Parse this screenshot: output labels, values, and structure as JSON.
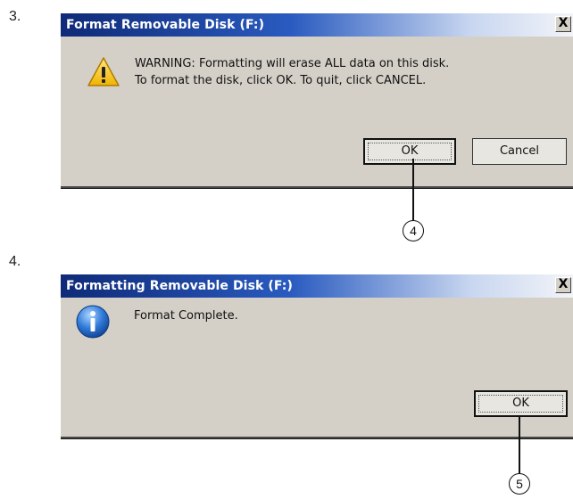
{
  "steps": {
    "step3": "3.",
    "step4": "4."
  },
  "dialog1": {
    "title": "Format Removable Disk (F:)",
    "close_label": "X",
    "icon": "warning-icon",
    "message_line1": "WARNING: Formatting will erase ALL data on this disk.",
    "message_line2": "To format the disk, click OK. To quit, click CANCEL.",
    "ok_label": "OK",
    "cancel_label": "Cancel",
    "callout": "4"
  },
  "dialog2": {
    "title": "Formatting Removable Disk (F:)",
    "close_label": "X",
    "icon": "info-icon",
    "message": "Format Complete.",
    "ok_label": "OK",
    "callout": "5"
  },
  "colors": {
    "titlebar_start": "#0f2a78",
    "titlebar_end": "#f2f4f8",
    "dialog_bg": "#d4d0c8"
  }
}
